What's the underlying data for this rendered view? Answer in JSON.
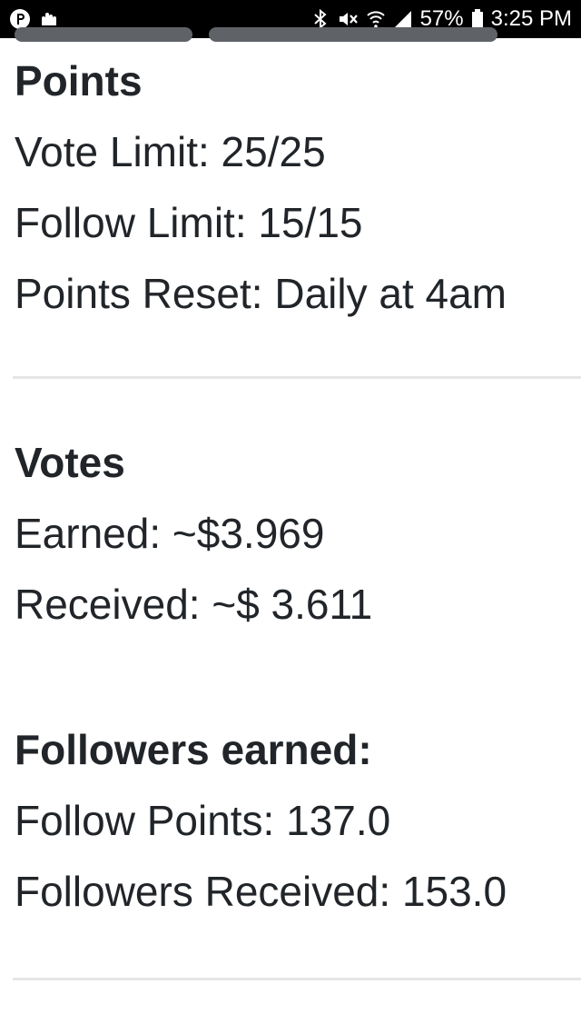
{
  "status_bar": {
    "battery_percent": "57%",
    "time": "3:25 PM",
    "icons": [
      "app-p-icon",
      "hand-icon",
      "bluetooth-icon",
      "mute-icon",
      "wifi-icon",
      "signal-icon",
      "battery-icon"
    ]
  },
  "points": {
    "title": "Points",
    "vote_limit": "Vote Limit: 25/25",
    "follow_limit": "Follow Limit: 15/15",
    "points_reset": "Points Reset: Daily at 4am"
  },
  "votes": {
    "title": "Votes",
    "earned": "Earned: ~$3.969",
    "received": "Received: ~$ 3.611"
  },
  "followers": {
    "title": "Followers earned:",
    "follow_points": "Follow Points: 137.0",
    "followers_received": "Followers Received: 153.0"
  }
}
